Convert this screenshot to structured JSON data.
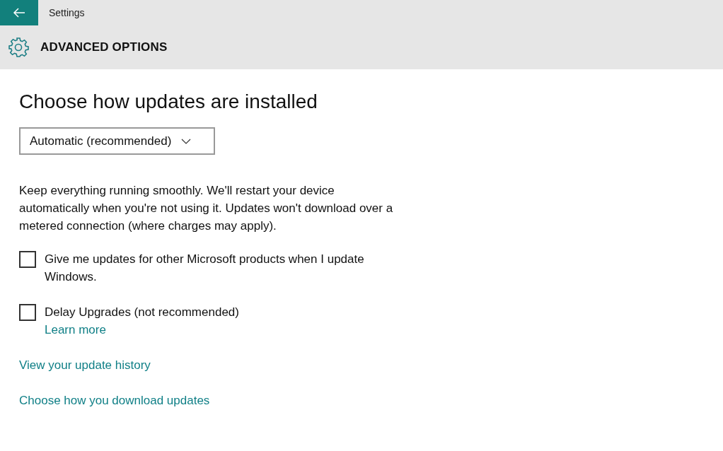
{
  "window": {
    "title": "Settings"
  },
  "page": {
    "title": "ADVANCED OPTIONS"
  },
  "section": {
    "heading": "Choose how updates are installed"
  },
  "dropdown": {
    "value": "Automatic (recommended)"
  },
  "description": "Keep everything running smoothly. We'll restart your device automatically when you're not using it. Updates won't download over a metered connection (where charges may apply).",
  "options": [
    {
      "label": "Give me updates for other Microsoft products when I update Windows.",
      "checked": false
    },
    {
      "label": "Delay Upgrades (not recommended)",
      "checked": false,
      "link": "Learn more"
    }
  ],
  "links": [
    "View your update history",
    "Choose how you download updates"
  ]
}
